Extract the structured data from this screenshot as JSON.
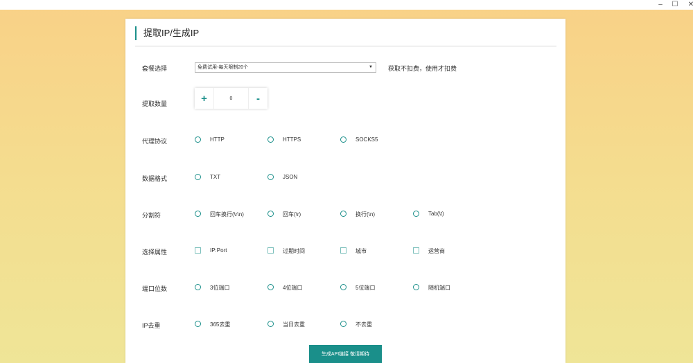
{
  "window": {
    "min": "–",
    "max": "☐",
    "close": "✕"
  },
  "title": "提取IP/生成IP",
  "package": {
    "label": "套餐选择",
    "value": "免费试用-每天限制20个",
    "note": "获取不扣费，使用才扣费"
  },
  "quantity": {
    "label": "提取数量",
    "plus": "+",
    "value": "0",
    "minus": "-"
  },
  "rows": [
    {
      "label": "代理协议",
      "type": "radio",
      "options": [
        "HTTP",
        "HTTPS",
        "SOCKS5"
      ]
    },
    {
      "label": "数据格式",
      "type": "radio",
      "options": [
        "TXT",
        "JSON"
      ]
    },
    {
      "label": "分割符",
      "type": "radio",
      "options": [
        "回车换行(\\r\\n)",
        "回车(\\r)",
        "换行(\\n)",
        "Tab(\\t)"
      ]
    },
    {
      "label": "选择属性",
      "type": "check",
      "options": [
        "IP:Port",
        "过期时间",
        "城市",
        "运营商"
      ]
    },
    {
      "label": "端口位数",
      "type": "radio",
      "options": [
        "3位端口",
        "4位端口",
        "5位端口",
        "随机端口"
      ]
    },
    {
      "label": "IP去重",
      "type": "radio",
      "options": [
        "365去重",
        "当日去重",
        "不去重"
      ]
    }
  ],
  "submit": "生成API链接 敬请期待",
  "colors": {
    "accent": "#1a8f8a"
  }
}
